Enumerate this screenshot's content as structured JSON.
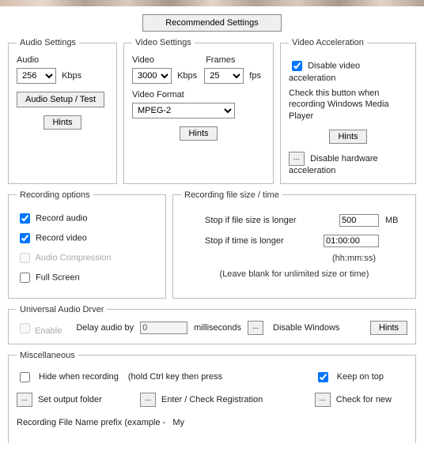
{
  "top": {
    "recommended_btn": "Recommended Settings"
  },
  "audio": {
    "legend": "Audio Settings",
    "label": "Audio",
    "value": "256",
    "unit": "Kbps",
    "setup_btn": "Audio Setup / Test",
    "hints_btn": "Hints"
  },
  "video": {
    "legend": "Video Settings",
    "label": "Video",
    "value": "3000",
    "unit": "Kbps",
    "frames_label": "Frames",
    "frames_value": "25",
    "frames_unit": "fps",
    "format_label": "Video Format",
    "format_value": "MPEG-2",
    "hints_btn": "Hints"
  },
  "accel": {
    "legend": "Video Acceleration",
    "disable_label": "Disable video acceleration",
    "disable_checked": true,
    "note": "Check this button when recording Windows Media Player",
    "hints_btn": "Hints",
    "hw_label": "Disable hardware acceleration"
  },
  "recopt": {
    "legend": "Recording options",
    "record_audio": "Record audio",
    "record_audio_checked": true,
    "record_video": "Record video",
    "record_video_checked": true,
    "audio_compression": "Audio Compression",
    "audio_compression_checked": false,
    "full_screen": "Full Screen",
    "full_screen_checked": false
  },
  "recfile": {
    "legend": "Recording file size / time",
    "size_label": "Stop if file size is longer",
    "size_value": "500",
    "size_unit": "MB",
    "time_label": "Stop if time is longer",
    "time_value": "01:00:00",
    "time_unit": "(hh:mm:ss)",
    "blank_note": "(Leave blank for unlimited size or time)"
  },
  "uad": {
    "legend": "Universal Audio Drver",
    "enable_label": "Enable",
    "enable_checked": false,
    "delay_label": "Delay audio by",
    "delay_value": "0",
    "delay_unit": "milliseconds",
    "disable_windows": "Disable Windows",
    "hints_btn": "Hints"
  },
  "misc": {
    "legend": "Miscellaneous",
    "hide_label": "Hide when recording",
    "hide_checked": false,
    "hide_note": "(hold Ctrl key then press",
    "keep_label": "Keep on top",
    "keep_checked": true,
    "set_output": "Set output folder",
    "enter_reg": "Enter / Check Registration",
    "check_new": "Check for new",
    "prefix_label": "Recording File Name prefix (example -",
    "prefix_value": "My"
  }
}
